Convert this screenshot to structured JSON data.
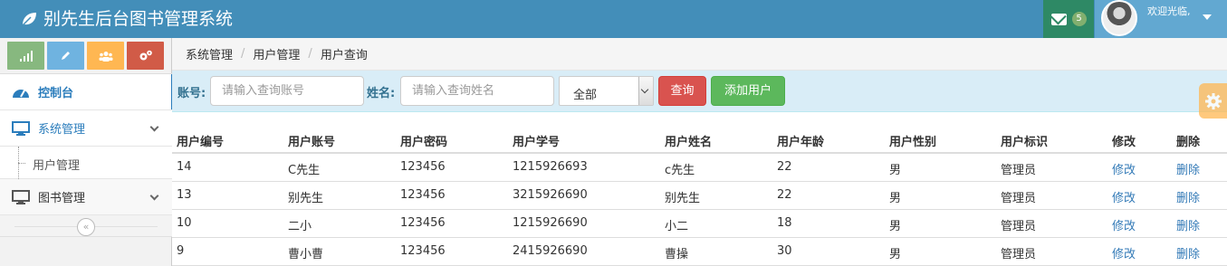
{
  "app": {
    "title": "别先生后台图书管理系统",
    "colors": {
      "navbar": "#438EB9",
      "accent": "#2B7DBC"
    }
  },
  "header": {
    "mail_icon": "envelope-icon",
    "mail_count": "5",
    "welcome": "欢迎光临,"
  },
  "shortcuts": [
    {
      "icon": "signal-icon",
      "color": "#87B87F"
    },
    {
      "icon": "pencil-icon",
      "color": "#6FB3E0"
    },
    {
      "icon": "users-icon",
      "color": "#FFB752"
    },
    {
      "icon": "cogs-icon",
      "color": "#D15B47"
    }
  ],
  "sidebar": {
    "dashboard": "控制台",
    "system": "系统管理",
    "user_mgmt": "用户管理",
    "books": "图书管理",
    "collapse": "«"
  },
  "breadcrumb": [
    "系统管理",
    "用户管理",
    "用户查询"
  ],
  "search": {
    "account_label": "账号:",
    "account_placeholder": "请输入查询账号",
    "name_label": "姓名:",
    "name_placeholder": "请输入查询姓名",
    "select_value": "全部",
    "query_button": "查询",
    "add_button": "添加用户"
  },
  "table": {
    "headers": [
      "用户编号",
      "用户账号",
      "用户密码",
      "用户学号",
      "用户姓名",
      "用户年龄",
      "用户性别",
      "用户标识",
      "修改",
      "删除"
    ],
    "rows": [
      [
        "14",
        "C先生",
        "123456",
        "1215926693",
        "c先生",
        "22",
        "男",
        "管理员",
        "修改",
        "删除"
      ],
      [
        "13",
        "别先生",
        "123456",
        "3215926690",
        "别先生",
        "22",
        "男",
        "管理员",
        "修改",
        "删除"
      ],
      [
        "10",
        "二小",
        "123456",
        "1215926690",
        "小二",
        "18",
        "男",
        "管理员",
        "修改",
        "删除"
      ],
      [
        "9",
        "曹小曹",
        "123456",
        "2415926690",
        "曹操",
        "30",
        "男",
        "管理员",
        "修改",
        "删除"
      ]
    ]
  }
}
